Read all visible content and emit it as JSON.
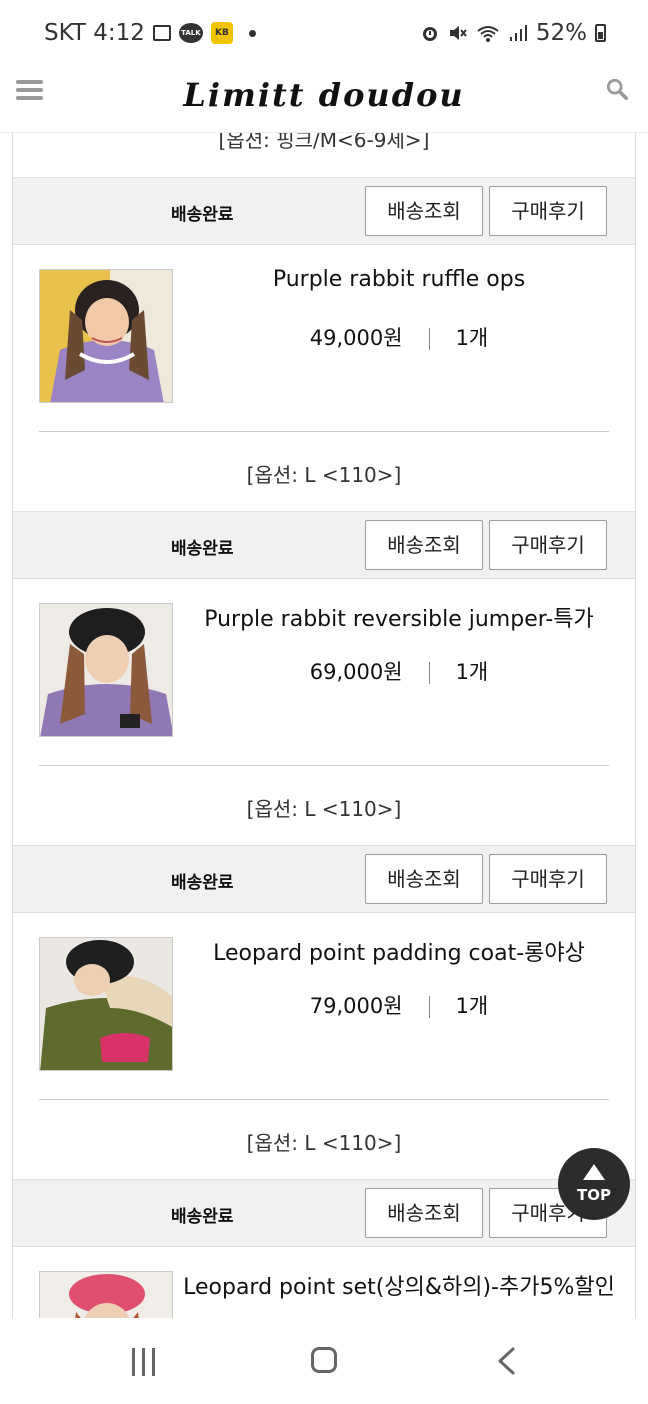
{
  "status": {
    "carrier_time": "SKT 4:12",
    "battery": "52%"
  },
  "header": {
    "logo": "Limitt doudou"
  },
  "top_option": "[옵션: 핑크/M<6-9세>]",
  "items": [
    {
      "status": "배송완료",
      "track_label": "배송조회",
      "review_label": "구매후기",
      "name": "Purple rabbit ruffle ops",
      "price": "49,000원",
      "qty": "1개",
      "option": "[옵션: L <110>]"
    },
    {
      "status": "배송완료",
      "track_label": "배송조회",
      "review_label": "구매후기",
      "name": "Purple rabbit reversible jumper-특가",
      "price": "69,000원",
      "qty": "1개",
      "option": "[옵션: L <110>]"
    },
    {
      "status": "배송완료",
      "track_label": "배송조회",
      "review_label": "구매후기",
      "name": "Leopard point padding coat-롱야상",
      "price": "79,000원",
      "qty": "1개",
      "option": "[옵션: L <110>]"
    },
    {
      "status": "배송완료",
      "track_label": "배송조회",
      "review_label": "구매후기",
      "name": "Leopard point set(상의&하의)-추가5%할인",
      "price": "",
      "qty": "",
      "option": ""
    }
  ],
  "top_button": "TOP",
  "icons": {
    "menu": "hamburger-icon",
    "search": "search-icon",
    "alarm": "alarm-icon",
    "mute": "mute-icon",
    "wifi": "wifi-icon",
    "signal": "signal-icon"
  }
}
